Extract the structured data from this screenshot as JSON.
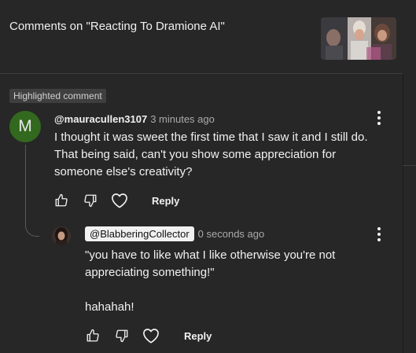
{
  "header": {
    "title": "Comments on \"Reacting To Dramione AI\""
  },
  "highlighted_label": "Highlighted comment",
  "comment": {
    "avatar_letter": "M",
    "author": "@mauracullen3107",
    "time": "3 minutes ago",
    "lines": [
      "I thought it was sweet the first time that I saw it and I still do.",
      "That being said, can't you show some appreciation for",
      "someone else's creativity?"
    ],
    "reply_label": "Reply"
  },
  "reply": {
    "author": "@BlabberingCollector",
    "time": "0 seconds ago",
    "lines": [
      "\"you have to like what I like otherwise you're not",
      "appreciating something!\"",
      "",
      "hahahah!"
    ],
    "reply_label": "Reply"
  },
  "colors": {
    "background": "#272727",
    "avatar_m": "#33691e",
    "badge": "#3f3f3f"
  }
}
